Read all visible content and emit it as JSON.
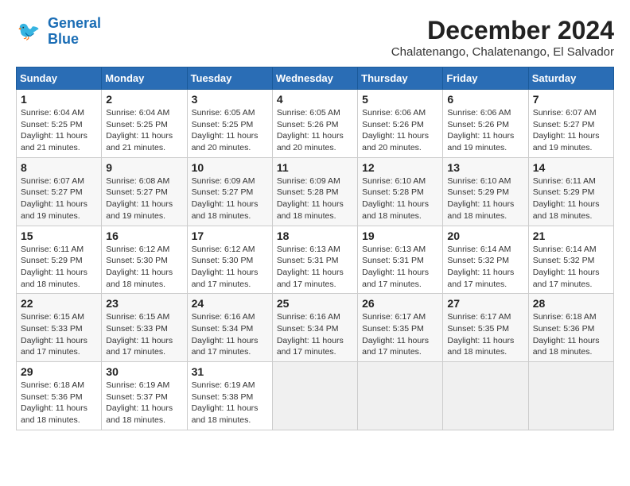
{
  "logo": {
    "line1": "General",
    "line2": "Blue"
  },
  "title": "December 2024",
  "subtitle": "Chalatenango, Chalatenango, El Salvador",
  "headers": [
    "Sunday",
    "Monday",
    "Tuesday",
    "Wednesday",
    "Thursday",
    "Friday",
    "Saturday"
  ],
  "weeks": [
    [
      {
        "day": "1",
        "sunrise": "6:04 AM",
        "sunset": "5:25 PM",
        "daylight": "11 hours and 21 minutes."
      },
      {
        "day": "2",
        "sunrise": "6:04 AM",
        "sunset": "5:25 PM",
        "daylight": "11 hours and 21 minutes."
      },
      {
        "day": "3",
        "sunrise": "6:05 AM",
        "sunset": "5:25 PM",
        "daylight": "11 hours and 20 minutes."
      },
      {
        "day": "4",
        "sunrise": "6:05 AM",
        "sunset": "5:26 PM",
        "daylight": "11 hours and 20 minutes."
      },
      {
        "day": "5",
        "sunrise": "6:06 AM",
        "sunset": "5:26 PM",
        "daylight": "11 hours and 20 minutes."
      },
      {
        "day": "6",
        "sunrise": "6:06 AM",
        "sunset": "5:26 PM",
        "daylight": "11 hours and 19 minutes."
      },
      {
        "day": "7",
        "sunrise": "6:07 AM",
        "sunset": "5:27 PM",
        "daylight": "11 hours and 19 minutes."
      }
    ],
    [
      {
        "day": "8",
        "sunrise": "6:07 AM",
        "sunset": "5:27 PM",
        "daylight": "11 hours and 19 minutes."
      },
      {
        "day": "9",
        "sunrise": "6:08 AM",
        "sunset": "5:27 PM",
        "daylight": "11 hours and 19 minutes."
      },
      {
        "day": "10",
        "sunrise": "6:09 AM",
        "sunset": "5:27 PM",
        "daylight": "11 hours and 18 minutes."
      },
      {
        "day": "11",
        "sunrise": "6:09 AM",
        "sunset": "5:28 PM",
        "daylight": "11 hours and 18 minutes."
      },
      {
        "day": "12",
        "sunrise": "6:10 AM",
        "sunset": "5:28 PM",
        "daylight": "11 hours and 18 minutes."
      },
      {
        "day": "13",
        "sunrise": "6:10 AM",
        "sunset": "5:29 PM",
        "daylight": "11 hours and 18 minutes."
      },
      {
        "day": "14",
        "sunrise": "6:11 AM",
        "sunset": "5:29 PM",
        "daylight": "11 hours and 18 minutes."
      }
    ],
    [
      {
        "day": "15",
        "sunrise": "6:11 AM",
        "sunset": "5:29 PM",
        "daylight": "11 hours and 18 minutes."
      },
      {
        "day": "16",
        "sunrise": "6:12 AM",
        "sunset": "5:30 PM",
        "daylight": "11 hours and 18 minutes."
      },
      {
        "day": "17",
        "sunrise": "6:12 AM",
        "sunset": "5:30 PM",
        "daylight": "11 hours and 17 minutes."
      },
      {
        "day": "18",
        "sunrise": "6:13 AM",
        "sunset": "5:31 PM",
        "daylight": "11 hours and 17 minutes."
      },
      {
        "day": "19",
        "sunrise": "6:13 AM",
        "sunset": "5:31 PM",
        "daylight": "11 hours and 17 minutes."
      },
      {
        "day": "20",
        "sunrise": "6:14 AM",
        "sunset": "5:32 PM",
        "daylight": "11 hours and 17 minutes."
      },
      {
        "day": "21",
        "sunrise": "6:14 AM",
        "sunset": "5:32 PM",
        "daylight": "11 hours and 17 minutes."
      }
    ],
    [
      {
        "day": "22",
        "sunrise": "6:15 AM",
        "sunset": "5:33 PM",
        "daylight": "11 hours and 17 minutes."
      },
      {
        "day": "23",
        "sunrise": "6:15 AM",
        "sunset": "5:33 PM",
        "daylight": "11 hours and 17 minutes."
      },
      {
        "day": "24",
        "sunrise": "6:16 AM",
        "sunset": "5:34 PM",
        "daylight": "11 hours and 17 minutes."
      },
      {
        "day": "25",
        "sunrise": "6:16 AM",
        "sunset": "5:34 PM",
        "daylight": "11 hours and 17 minutes."
      },
      {
        "day": "26",
        "sunrise": "6:17 AM",
        "sunset": "5:35 PM",
        "daylight": "11 hours and 17 minutes."
      },
      {
        "day": "27",
        "sunrise": "6:17 AM",
        "sunset": "5:35 PM",
        "daylight": "11 hours and 18 minutes."
      },
      {
        "day": "28",
        "sunrise": "6:18 AM",
        "sunset": "5:36 PM",
        "daylight": "11 hours and 18 minutes."
      }
    ],
    [
      {
        "day": "29",
        "sunrise": "6:18 AM",
        "sunset": "5:36 PM",
        "daylight": "11 hours and 18 minutes."
      },
      {
        "day": "30",
        "sunrise": "6:19 AM",
        "sunset": "5:37 PM",
        "daylight": "11 hours and 18 minutes."
      },
      {
        "day": "31",
        "sunrise": "6:19 AM",
        "sunset": "5:38 PM",
        "daylight": "11 hours and 18 minutes."
      },
      null,
      null,
      null,
      null
    ]
  ],
  "labels": {
    "sunrise": "Sunrise:",
    "sunset": "Sunset:",
    "daylight": "Daylight:"
  }
}
